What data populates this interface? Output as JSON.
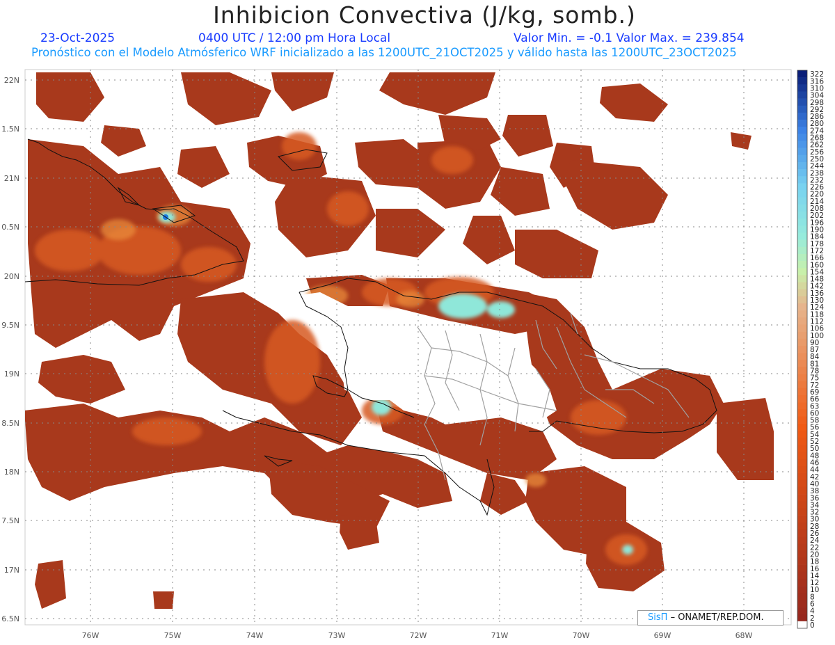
{
  "header": {
    "title": "Inhibicion Convectiva (J/kg, somb.)",
    "date": "23-Oct-2025",
    "time": "0400 UTC / 12:00 pm Hora Local",
    "minmax": "Valor Min. = -0.1  Valor Max. = 239.854",
    "subtitle": "Pronóstico con el Modelo Atmósferico WRF inicializado a las 1200UTC_21OCT2025 y válido hasta las  1200UTC_23OCT2025"
  },
  "axes": {
    "lat_labels": [
      "22N",
      "1.5N",
      "21N",
      "0.5N",
      "20N",
      "9.5N",
      "19N",
      "8.5N",
      "18N",
      "7.5N",
      "17N",
      "6.5N"
    ],
    "lon_labels": [
      "76W",
      "75W",
      "74W",
      "73W",
      "72W",
      "71W",
      "70W",
      "69W",
      "68W"
    ]
  },
  "colorbar": {
    "labels": [
      "322",
      "316",
      "310",
      "304",
      "298",
      "292",
      "286",
      "280",
      "274",
      "268",
      "262",
      "256",
      "250",
      "244",
      "238",
      "232",
      "226",
      "220",
      "214",
      "208",
      "202",
      "196",
      "190",
      "184",
      "178",
      "172",
      "166",
      "160",
      "154",
      "148",
      "142",
      "136",
      "130",
      "124",
      "118",
      "112",
      "106",
      "100",
      "90",
      "87",
      "84",
      "81",
      "78",
      "75",
      "72",
      "69",
      "66",
      "63",
      "60",
      "58",
      "56",
      "54",
      "52",
      "50",
      "48",
      "46",
      "44",
      "42",
      "40",
      "38",
      "36",
      "34",
      "32",
      "30",
      "28",
      "26",
      "24",
      "22",
      "20",
      "18",
      "16",
      "14",
      "12",
      "10",
      "8",
      "6",
      "4",
      "2",
      "0"
    ]
  },
  "credit": {
    "brand": "SisΠ",
    "org": "– ONAMET/REP.DOM."
  },
  "colors": {
    "field_low": "#a8391c",
    "field_mid": "#d75a20",
    "field_hi": "#e98a3a",
    "cyan": "#8fe7d9",
    "blue": "#1d4fc9"
  }
}
